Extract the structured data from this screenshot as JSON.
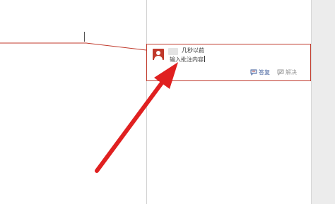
{
  "comment": {
    "time": "几秒以前",
    "text": "输入批注内容",
    "reply_label": "答复",
    "resolve_label": "解决"
  },
  "icons": {
    "avatar": "user-avatar-icon",
    "reply": "reply-bubble-icon",
    "resolve": "resolve-bubble-icon"
  },
  "colors": {
    "accent": "#c0392b",
    "reply": "#3b5b9a",
    "resolve": "#9a9a9a",
    "gutter": "#ececec"
  }
}
